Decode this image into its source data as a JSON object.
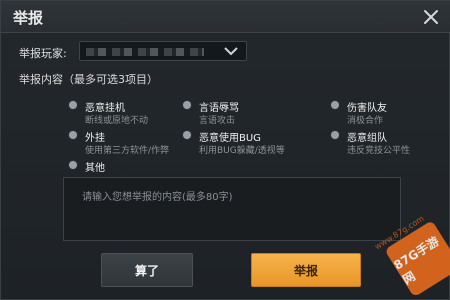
{
  "dialog": {
    "title": "举报",
    "close_icon": "close-icon",
    "player_label": "举报玩家:",
    "player_value": "",
    "dropdown_icon": "chevron-down-icon",
    "section_label": "举报内容（最多可选3项目）",
    "options": [
      {
        "title": "恶意挂机",
        "subtitle": "断线或原地不动"
      },
      {
        "title": "言语辱骂",
        "subtitle": "言语攻击"
      },
      {
        "title": "伤害队友",
        "subtitle": "消极合作"
      },
      {
        "title": "外挂",
        "subtitle": "使用第三方软件/作弊"
      },
      {
        "title": "恶意使用BUG",
        "subtitle": "利用BUG躲藏/透视等"
      },
      {
        "title": "恶意组队",
        "subtitle": "违反竞技公平性"
      },
      {
        "title": "其他",
        "subtitle": ""
      }
    ],
    "textarea_placeholder": "请输入您想举报的内容(最多80字)",
    "buttons": {
      "cancel": "算了",
      "report": "举报"
    }
  },
  "watermark": {
    "site": "www.87g.com",
    "brand": "87G手游网"
  },
  "colors": {
    "accent": "#F2A43A",
    "background": "#23282D",
    "titlebar": "#2F3439"
  }
}
